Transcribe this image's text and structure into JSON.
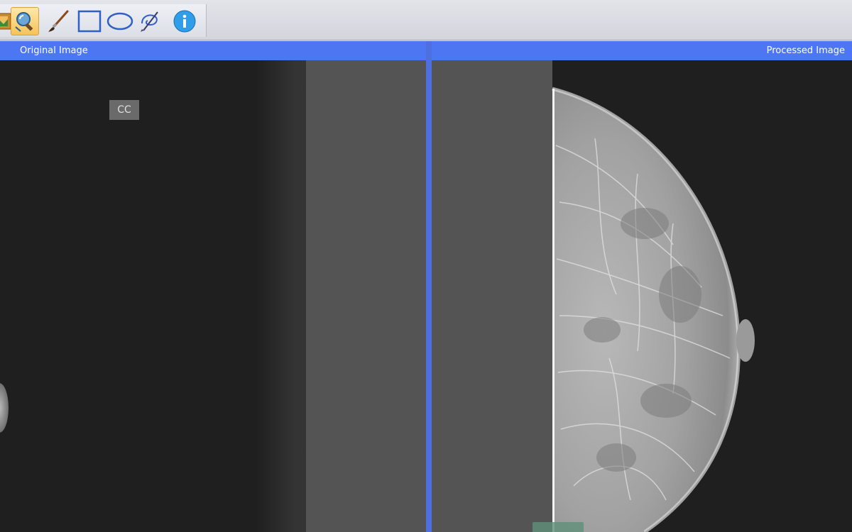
{
  "toolbar": {
    "tools": [
      {
        "id": "open",
        "icon": "image-open-icon"
      },
      {
        "id": "select",
        "icon": "magnifier-select-icon",
        "active": true
      },
      {
        "id": "brush",
        "icon": "paintbrush-icon"
      },
      {
        "id": "rectangle",
        "icon": "rectangle-icon"
      },
      {
        "id": "ellipse",
        "icon": "ellipse-icon"
      },
      {
        "id": "freehand",
        "icon": "freehand-lasso-icon"
      },
      {
        "id": "info",
        "icon": "info-icon"
      }
    ]
  },
  "panels": {
    "left": {
      "title": "Original Image",
      "view_label": "CC"
    },
    "right": {
      "title": "Processed Image"
    }
  },
  "colors": {
    "header_bar": "#4d77f2",
    "divider": "#4d6fe0",
    "viewer_background": "#1f1f1f",
    "side_strip": "#545454",
    "info_icon": "#2f9de8"
  }
}
